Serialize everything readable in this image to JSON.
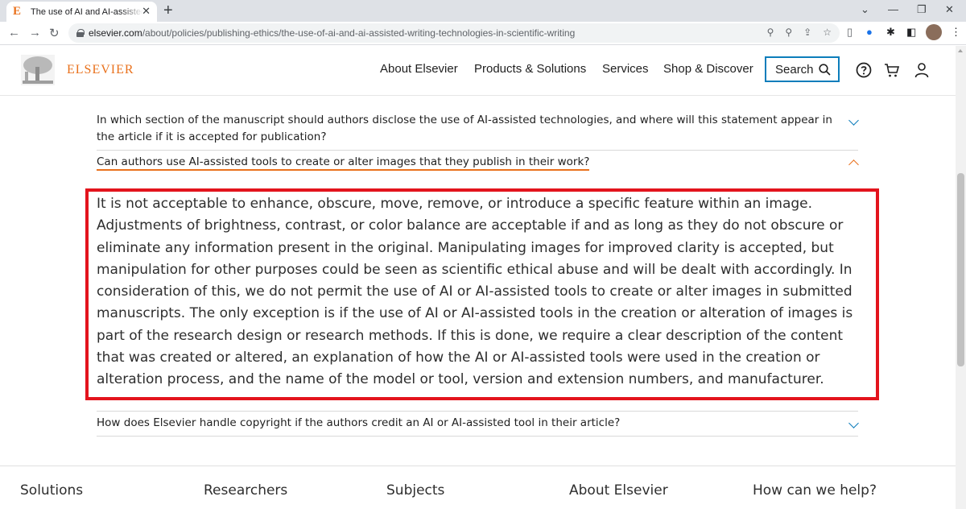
{
  "browser": {
    "tab_title": "The use of AI and AI-assisted wri",
    "tab_favicon": "E",
    "new_tab": "+",
    "url_host": "elsevier.com",
    "url_path": "/about/policies/publishing-ethics/the-use-of-ai-and-ai-assisted-writing-technologies-in-scientific-writing"
  },
  "header": {
    "brand": "ELSEVIER",
    "nav": [
      "About Elsevier",
      "Products & Solutions",
      "Services",
      "Shop & Discover"
    ],
    "search_label": "Search"
  },
  "faq": {
    "q_prev": "In which section of the manuscript should authors disclose the use of AI-assisted technologies, and where will this statement appear in the article if it is accepted for publication?",
    "q_open": "Can authors use AI-assisted tools to create or alter images that they publish in their work?",
    "answer": "It is not acceptable to enhance, obscure, move, remove, or introduce a specific feature within an image. Adjustments of brightness, contrast, or color balance are acceptable if and as long as they do not obscure or eliminate any information present in the original. Manipulating images for improved clarity is accepted, but manipulation for other purposes could be seen as scientific ethical abuse and will be dealt with accordingly. In consideration of this, we do not permit the use of AI or AI-assisted tools to create or alter images in submitted manuscripts. The only exception is if the use of AI or AI-assisted tools in the creation or alteration of images is part of the research design or research methods. If this is done, we require a clear description of the content that was created or altered, an explanation of how the AI or AI-assisted tools were used in the creation or alteration process, and the name of the model or tool, version and extension numbers, and manufacturer.",
    "q_next": "How does Elsevier handle copyright if the authors credit an AI or AI-assisted tool in their article?"
  },
  "footer": [
    "Solutions",
    "Researchers",
    "Subjects",
    "About Elsevier",
    "How can we help?"
  ],
  "colors": {
    "brand_orange": "#e9711c",
    "accent_blue": "#0c7dbb",
    "highlight_red": "#e3141d"
  }
}
